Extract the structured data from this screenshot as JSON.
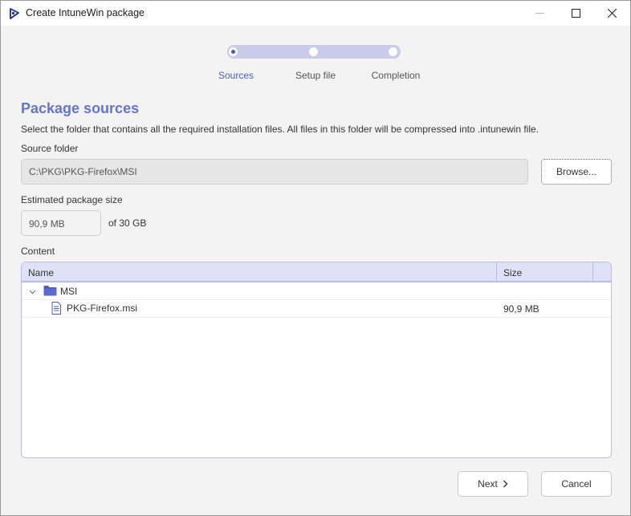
{
  "window": {
    "title": "Create IntuneWin package",
    "icon": "intunewin-app-icon"
  },
  "stepper": {
    "steps": [
      {
        "label": "Sources",
        "active": true
      },
      {
        "label": "Setup file",
        "active": false
      },
      {
        "label": "Completion",
        "active": false
      }
    ]
  },
  "page": {
    "title": "Package sources",
    "description": "Select the folder that contains all the required installation files. All files in this folder will be compressed into .intunewin file."
  },
  "source_folder": {
    "label": "Source folder",
    "value": "C:\\PKG\\PKG-Firefox\\MSI",
    "browse_label": "Browse..."
  },
  "package_size": {
    "label": "Estimated package size",
    "value": "90,9 MB",
    "suffix": "of 30 GB"
  },
  "content": {
    "label": "Content",
    "columns": {
      "name": "Name",
      "size": "Size"
    },
    "rows": [
      {
        "type": "folder",
        "name": "MSI",
        "size": "",
        "expanded": true
      },
      {
        "type": "file",
        "name": "PKG-Firefox.msi",
        "size": "90,9 MB"
      }
    ]
  },
  "footer": {
    "next_label": "Next",
    "cancel_label": "Cancel"
  },
  "colors": {
    "accent": "#6474cf",
    "step_track": "#c8cce8",
    "table_header": "#dfe2f7",
    "folder_icon": "#4a5cc4"
  }
}
